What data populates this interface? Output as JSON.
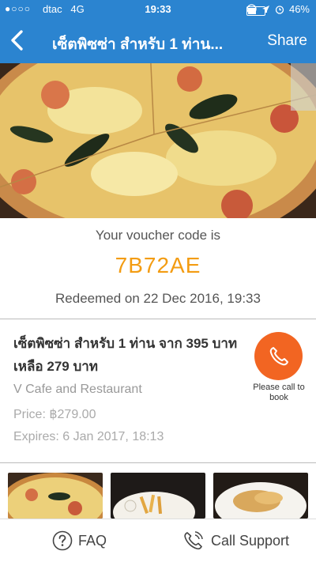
{
  "status_bar": {
    "signal": "●○○○",
    "carrier": "dtac",
    "network": "4G",
    "time": "19:33",
    "battery": "46%",
    "battery_level": 0.46
  },
  "nav": {
    "title": "เซ็ตพิซซ่า สำหรับ 1 ท่าน...",
    "share_label": "Share"
  },
  "voucher": {
    "label": "Your voucher code is",
    "code": "7B72AE",
    "redeemed": "Redeemed on 22 Dec 2016, 19:33"
  },
  "deal": {
    "title": "เซ็ตพิซซ่า สำหรับ 1 ท่าน จาก 395 บาท เหลือ 279 บาท",
    "venue": "V Cafe and Restaurant",
    "price": "Price: ฿279.00",
    "expires": "Expires: 6 Jan 2017, 18:13",
    "call_label": "Please call to book"
  },
  "footer": {
    "faq_label": "FAQ",
    "support_label": "Call Support"
  },
  "colors": {
    "primary": "#2b84d0",
    "accent": "#f39c12",
    "call": "#f26522"
  }
}
